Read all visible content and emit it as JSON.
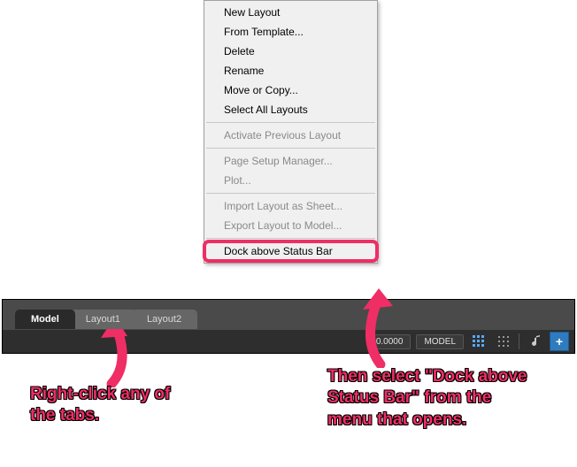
{
  "contextMenu": {
    "items": [
      {
        "label": "New Layout",
        "enabled": true
      },
      {
        "label": "From Template...",
        "enabled": true
      },
      {
        "label": "Delete",
        "enabled": true
      },
      {
        "label": "Rename",
        "enabled": true
      },
      {
        "label": "Move or Copy...",
        "enabled": true
      },
      {
        "label": "Select All Layouts",
        "enabled": true
      },
      {
        "sep": true
      },
      {
        "label": "Activate Previous Layout",
        "enabled": false
      },
      {
        "sep": true
      },
      {
        "label": "Page Setup Manager...",
        "enabled": false
      },
      {
        "label": "Plot...",
        "enabled": false
      },
      {
        "sep": true
      },
      {
        "label": "Import Layout as Sheet...",
        "enabled": false
      },
      {
        "label": "Export Layout to Model...",
        "enabled": false
      },
      {
        "sep": true
      },
      {
        "label": "Dock above Status Bar",
        "enabled": true,
        "highlight": true
      }
    ]
  },
  "tabs": [
    {
      "label": "Model",
      "active": true
    },
    {
      "label": "Layout1",
      "active": false
    },
    {
      "label": "Layout2",
      "active": false
    }
  ],
  "statusBar": {
    "readout": "0.0000",
    "spaceButton": "MODEL"
  },
  "annotations": {
    "left": "Right-click any of the tabs.",
    "right": "Then select \"Dock above Status Bar\" from the menu that opens."
  },
  "colors": {
    "accent": "#ef2e66"
  }
}
